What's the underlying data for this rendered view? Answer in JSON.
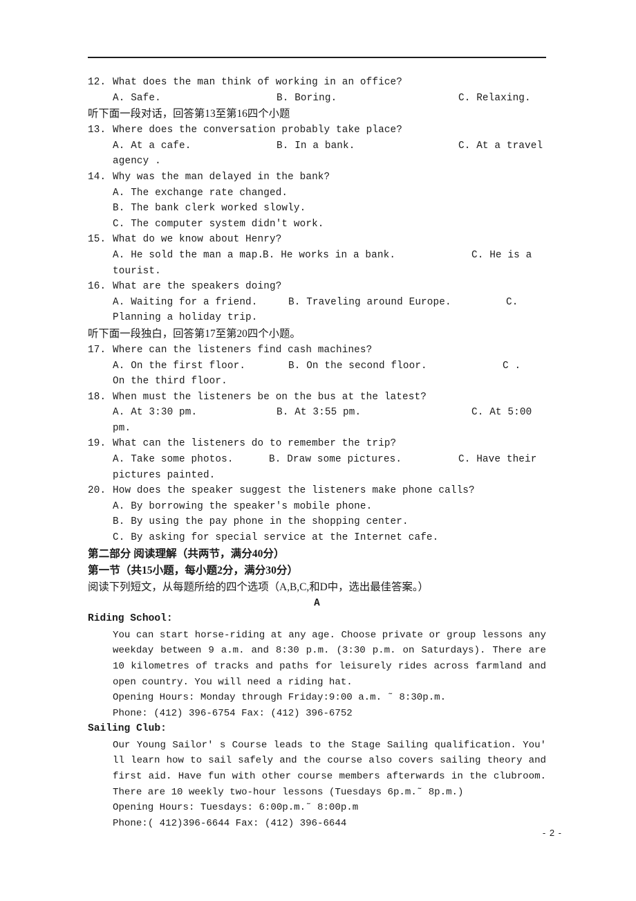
{
  "document": {
    "page_number": "- 2 -"
  },
  "listening": {
    "q12": {
      "number": "12.",
      "text": "What does the man think of working in an office?",
      "options": [
        "A. Safe.",
        "B. Boring.",
        "C. Relaxing."
      ]
    },
    "direction1": "听下面一段对话，回答第13至第16四个小题",
    "q13": {
      "number": "13.",
      "text": "Where does the conversation probably take place?",
      "options": [
        "A. At a cafe.",
        "B. In a bank.",
        "C. At a travel"
      ],
      "wrap": "agency ."
    },
    "q14": {
      "number": "14.",
      "text": "Why was the man delayed in the bank?",
      "options": [
        "A. The exchange rate changed.",
        "B. The bank clerk worked slowly.",
        "C. The computer system didn't work."
      ]
    },
    "q15": {
      "number": "15.",
      "text": "What do we know about Henry?",
      "options": [
        "A. He sold the man a map.",
        "B. He works in a bank.",
        "C.  He  is  a"
      ],
      "wrap": "tourist."
    },
    "q16": {
      "number": "16.",
      "text": "What are the speakers doing?",
      "options": [
        "A. Waiting for a friend.",
        "B. Traveling around Europe.",
        "C."
      ],
      "wrap": "Planning a holiday trip."
    },
    "direction2": "听下面一段独白，回答第17至第20四个小题。",
    "q17": {
      "number": "17.",
      "text": "Where can the listeners find cash machines?",
      "options": [
        "A. On the first floor.",
        "B. On the second floor.",
        "C  ."
      ],
      "wrap": "On the third floor."
    },
    "q18": {
      "number": "18.",
      "text": "When must the listeners be on the bus at the latest?",
      "options": [
        "A. At 3:30 pm.",
        "B.  At 3:55 pm.",
        "C.   At  5:00"
      ],
      "wrap": "pm."
    },
    "q19": {
      "number": "19.",
      "text": "What can the listeners do to remember the trip?",
      "options": [
        "A. Take some photos.",
        "B. Draw some pictures.",
        "C. Have their"
      ],
      "wrap": "pictures painted."
    },
    "q20": {
      "number": "20.",
      "text": "How does the speaker suggest the listeners make phone calls?",
      "options": [
        "A. By borrowing the speaker's mobile phone.",
        "B. By using the pay phone in the shopping center.",
        "C. By asking for special service at the Internet cafe."
      ]
    }
  },
  "part_two": {
    "heading": "第二部分  阅读理解（共两节，满分40分）",
    "section_heading": "第一节（共15小题，每小题2分，满分30分）",
    "instruction": "阅读下列短文，从每题所给的四个选项（A,B,C,和D中，选出最佳答案。）",
    "passage_label": "A",
    "riding_school": {
      "title": "Riding School:",
      "body": "You can start horse-riding at any age. Choose private or group lessons any weekday between 9 a.m. and 8:30 p.m. (3:30 p.m. on Saturdays). There are 10 kilometres of tracks and paths for leisurely rides across farmland and open country. You will need a riding hat.",
      "hours": "Opening Hours: Monday through Friday:9:00 a.m. ˜ 8:30p.m.",
      "phone": "Phone: (412) 396-6754 Fax: (412) 396-6752"
    },
    "sailing_club": {
      "title": "Sailing Club:",
      "body": "Our Young Sailor' s Course leads to the Stage Sailing qualification. You' ll learn how to sail safely and the course also covers sailing theory and first aid. Have fun with other course members afterwards in the clubroom. There are 10 weekly two-hour lessons (Tuesdays 6p.m.˜ 8p.m.)",
      "hours": "Opening Hours: Tuesdays: 6:00p.m.˜ 8:00p.m",
      "phone": "Phone:( 412)396-6644   Fax: (412) 396-6644"
    }
  }
}
